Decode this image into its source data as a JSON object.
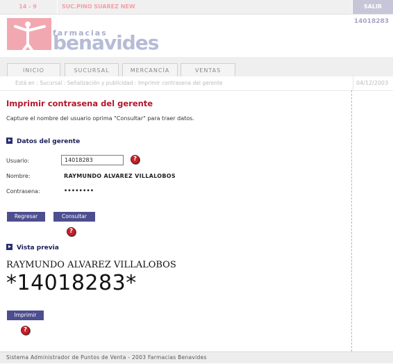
{
  "header": {
    "store_code": "14 - 9",
    "store_name": "SUC.PINO SUAREZ NEW",
    "exit_label": "SALIR",
    "user_id": "14018283"
  },
  "logo": {
    "top_text": "farmacias",
    "main_text": "benavides",
    "color": "#b6bcd6",
    "accent": "#f2a8b0"
  },
  "nav": {
    "tabs": [
      {
        "label": "INICIO"
      },
      {
        "label": "SUCURSAL"
      },
      {
        "label": "MERCANCÍA"
      },
      {
        "label": "VENTAS"
      }
    ]
  },
  "breadcrumb": {
    "text": "Está en : Sucursal : Señalización y publicidad : Imprimir contrasena del gerente",
    "date": "04/12/2003"
  },
  "main": {
    "title": "Imprimir contrasena del gerente",
    "instructions": "Capture el nombre del usuario oprima \"Consultar\" para traer datos.",
    "section_manager": "Datos del gerente",
    "usuario_label": "Usuario:",
    "usuario_value": "14018283",
    "nombre_label": "Nombre:",
    "nombre_value": "RAYMUNDO ALVAREZ VILLALOBOS",
    "contrasena_label": "Contrasena:",
    "contrasena_value": "••••••••",
    "back_button": "Regresar",
    "consult_button": "Consultar",
    "section_preview": "Vista previa",
    "preview_name": "RAYMUNDO ALVAREZ VILLALOBOS",
    "preview_code": "*14018283*",
    "print_button": "Imprimir"
  },
  "footer": {
    "text": "Sistema Administrador de Puntos de Venta - 2003 Farmacias Benavides"
  },
  "colors": {
    "title_red": "#b2162b",
    "button_blue": "#4d4e8f",
    "section_navy": "#1a1f59"
  }
}
